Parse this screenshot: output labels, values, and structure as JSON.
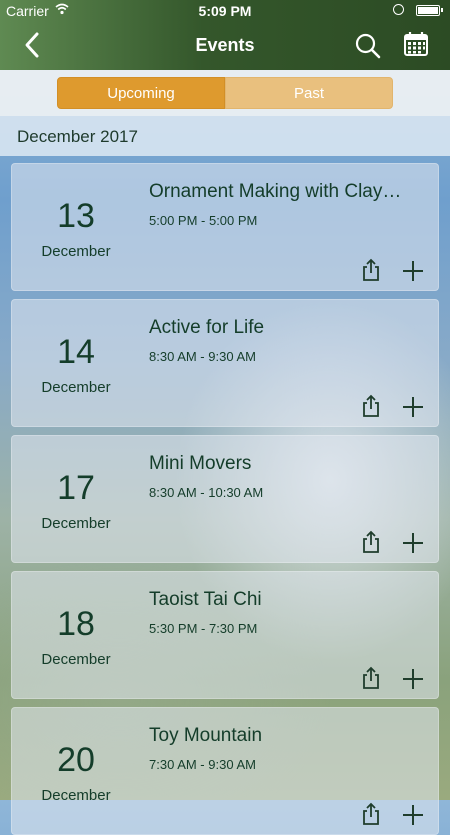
{
  "status_bar": {
    "carrier": "Carrier",
    "time": "5:09 PM"
  },
  "nav": {
    "title": "Events",
    "back_icon": "chevron-left-icon",
    "search_icon": "search-icon",
    "calendar_icon": "calendar-icon"
  },
  "tabs": {
    "upcoming": "Upcoming",
    "past": "Past",
    "selected": "Upcoming"
  },
  "section": {
    "label": "December 2017"
  },
  "events": [
    {
      "day": "13",
      "month": "December",
      "title": "Ornament Making with Clay…",
      "time": "5:00 PM - 5:00 PM"
    },
    {
      "day": "14",
      "month": "December",
      "title": "Active for Life",
      "time": "8:30 AM - 9:30 AM"
    },
    {
      "day": "17",
      "month": "December",
      "title": "Mini Movers",
      "time": "8:30 AM - 10:30 AM"
    },
    {
      "day": "18",
      "month": "December",
      "title": "Taoist Tai Chi",
      "time": "5:30 PM - 7:30 PM"
    },
    {
      "day": "20",
      "month": "December",
      "title": "Toy Mountain",
      "time": "7:30 AM - 9:30 AM"
    }
  ],
  "colors": {
    "header_green": "#34572b",
    "accent_orange": "#de9a2e",
    "text_green": "#143d2a"
  }
}
